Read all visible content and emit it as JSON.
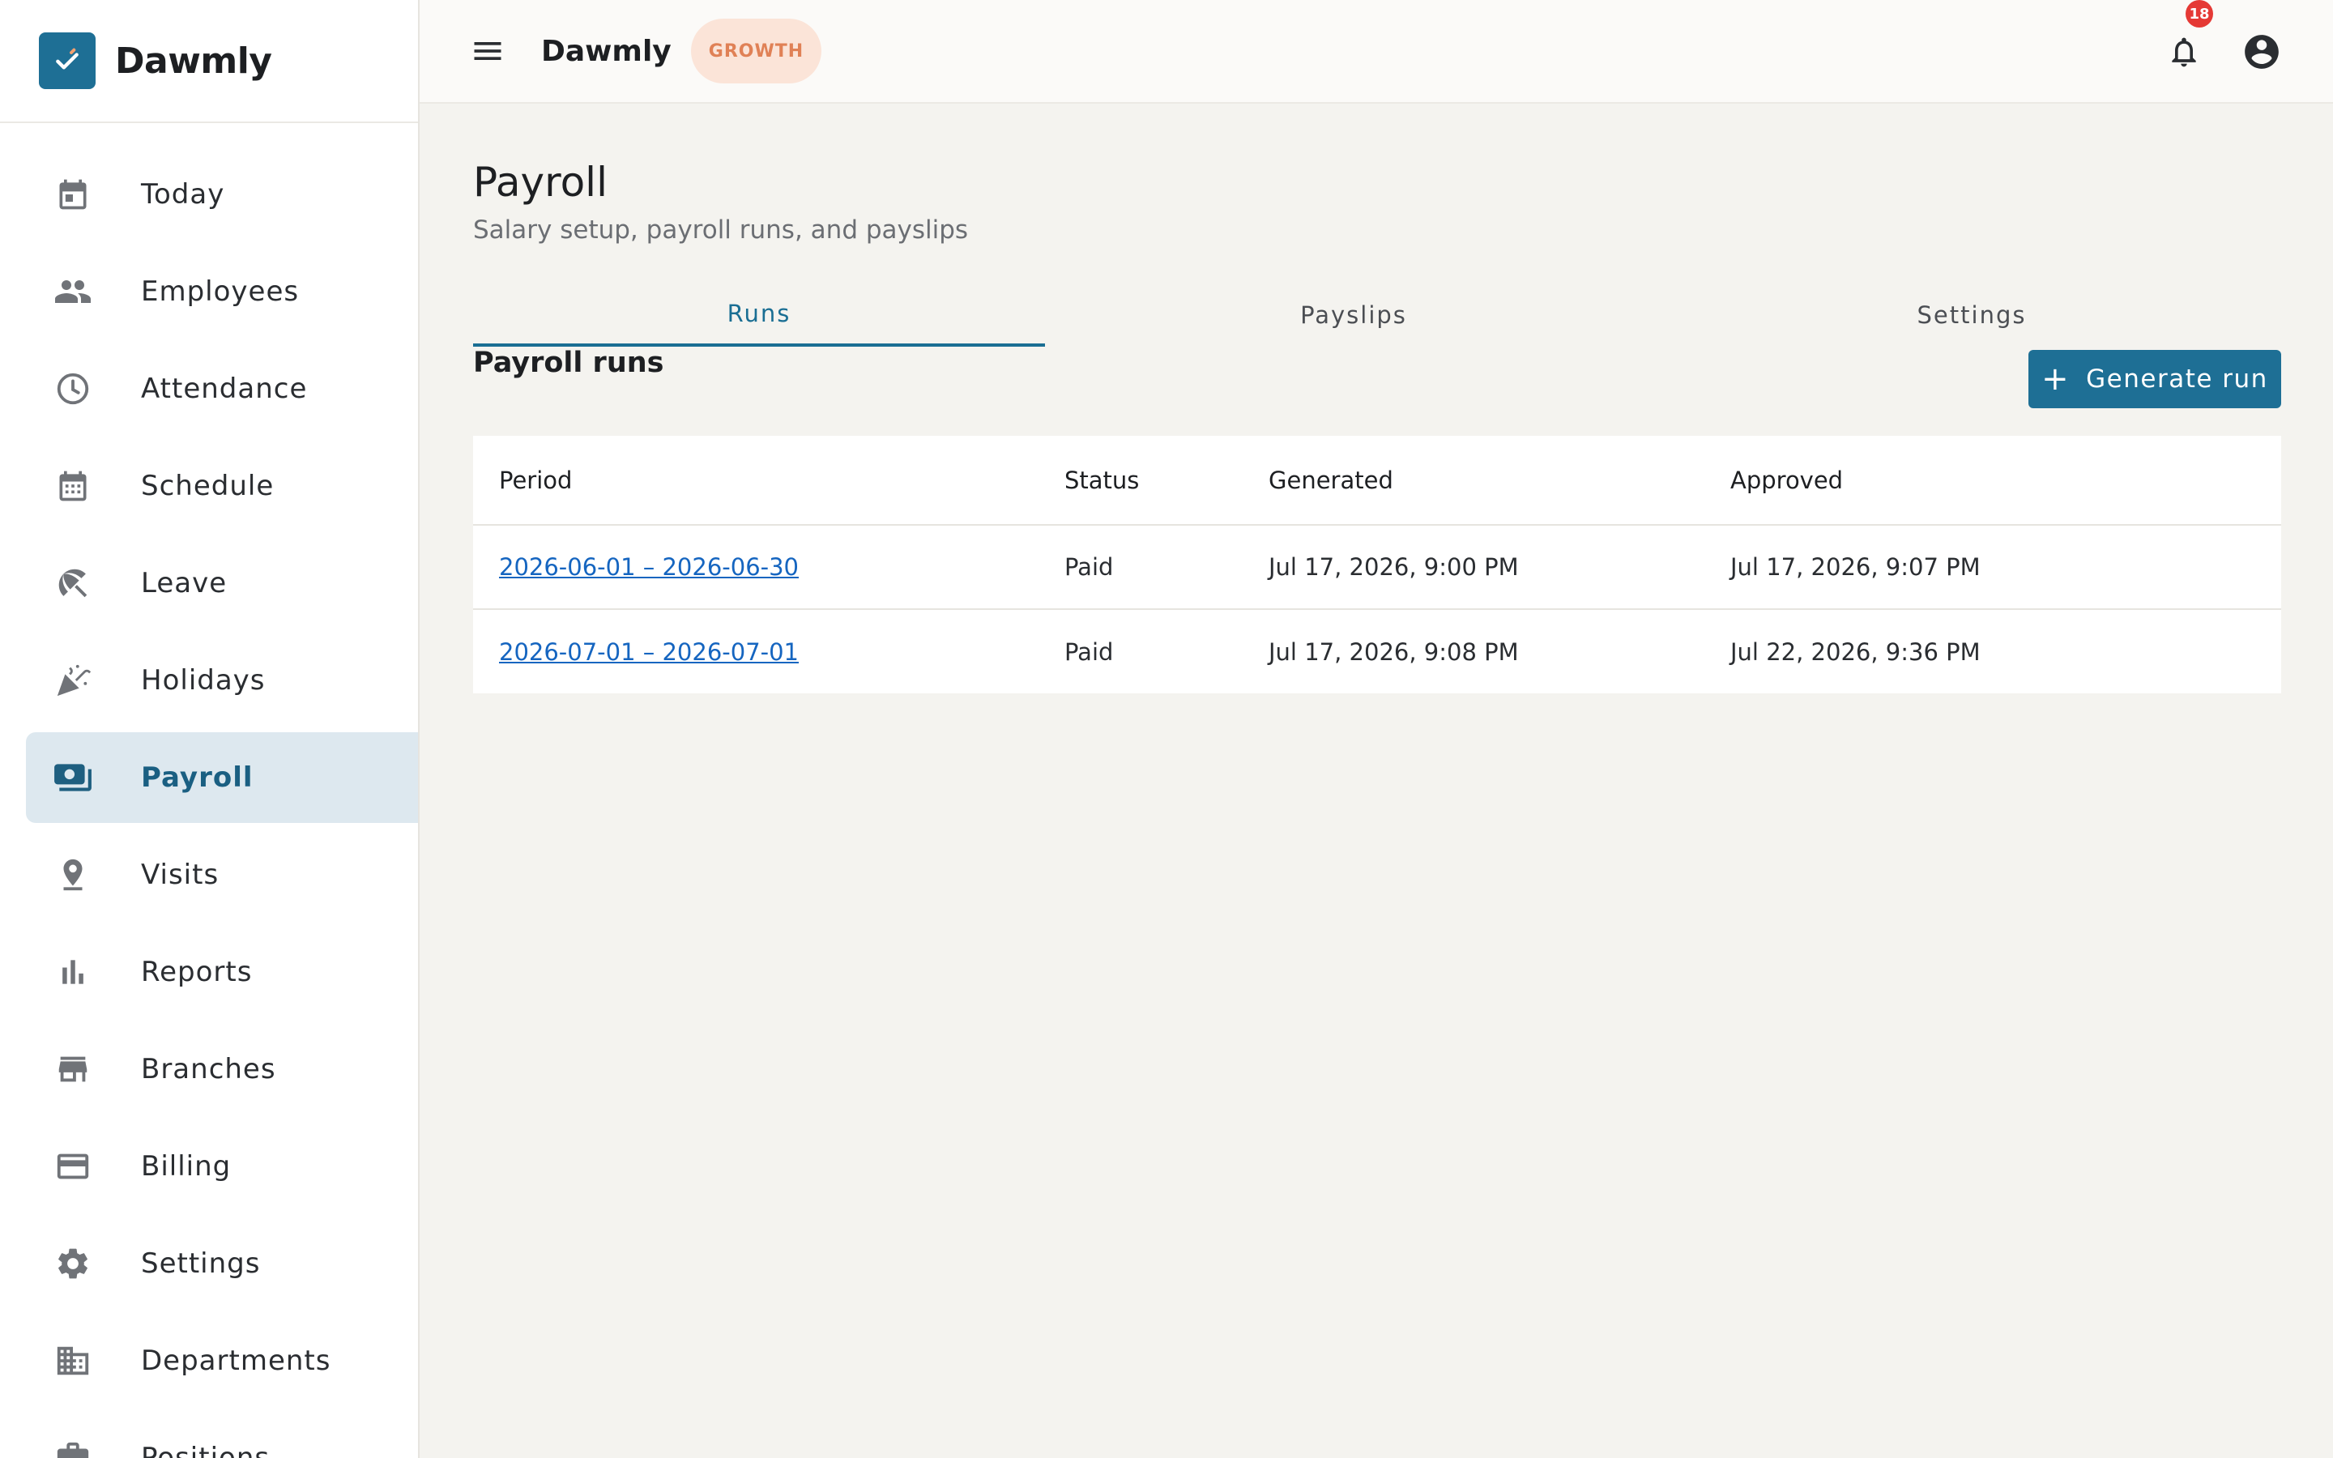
{
  "brand": {
    "name": "Dawmly"
  },
  "topbar": {
    "title": "Dawmly",
    "plan_badge": "GROWTH",
    "notification_count": "18"
  },
  "sidebar": {
    "items": [
      {
        "label": "Today",
        "icon": "calendar-today-icon"
      },
      {
        "label": "Employees",
        "icon": "people-icon"
      },
      {
        "label": "Attendance",
        "icon": "clock-icon"
      },
      {
        "label": "Schedule",
        "icon": "calendar-grid-icon"
      },
      {
        "label": "Leave",
        "icon": "beach-umbrella-icon"
      },
      {
        "label": "Holidays",
        "icon": "celebration-icon"
      },
      {
        "label": "Payroll",
        "icon": "money-icon",
        "active": true
      },
      {
        "label": "Visits",
        "icon": "location-pin-icon"
      },
      {
        "label": "Reports",
        "icon": "bar-chart-icon"
      },
      {
        "label": "Branches",
        "icon": "store-icon"
      },
      {
        "label": "Billing",
        "icon": "credit-card-icon"
      },
      {
        "label": "Settings",
        "icon": "gear-icon"
      },
      {
        "label": "Departments",
        "icon": "building-icon"
      },
      {
        "label": "Positions",
        "icon": "briefcase-icon"
      }
    ]
  },
  "page": {
    "title": "Payroll",
    "subtitle": "Salary setup, payroll runs, and payslips"
  },
  "tabs": [
    {
      "label": "Runs",
      "active": true
    },
    {
      "label": "Payslips"
    },
    {
      "label": "Settings"
    }
  ],
  "runs": {
    "title": "Payroll runs",
    "generate_label": "Generate run",
    "columns": [
      "Period",
      "Status",
      "Generated",
      "Approved"
    ],
    "rows": [
      {
        "period": "2026-06-01 – 2026-06-30",
        "status": "Paid",
        "generated": "Jul 17, 2026, 9:00 PM",
        "approved": "Jul 17, 2026, 9:07 PM"
      },
      {
        "period": "2026-07-01 – 2026-07-01",
        "status": "Paid",
        "generated": "Jul 17, 2026, 9:08 PM",
        "approved": "Jul 22, 2026, 9:36 PM"
      }
    ]
  },
  "colors": {
    "accent": "#1e6f95",
    "active_bg": "#dde8ef",
    "badge_bg": "#fbe4d8",
    "badge_text": "#e08156",
    "notification": "#e53935"
  }
}
